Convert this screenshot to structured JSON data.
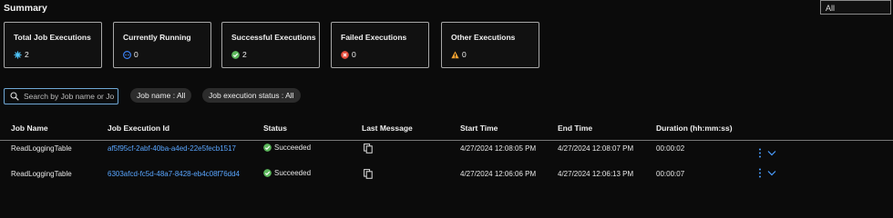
{
  "summary": {
    "title": "Summary",
    "filter_value": "All",
    "cards": [
      {
        "label": "Total Job Executions",
        "value": "2",
        "icon": "gear-icon",
        "color": "#4fc3f7"
      },
      {
        "label": "Currently Running",
        "value": "0",
        "icon": "running-icon",
        "color": "#3b82f6"
      },
      {
        "label": "Successful Executions",
        "value": "2",
        "icon": "check-circle-icon",
        "color": "#5cb85c"
      },
      {
        "label": "Failed Executions",
        "value": "0",
        "icon": "error-circle-icon",
        "color": "#e74c3c"
      },
      {
        "label": "Other Executions",
        "value": "0",
        "icon": "warning-icon",
        "color": "#f0a030"
      }
    ]
  },
  "filters": {
    "search_placeholder": "Search by Job name or Jo...",
    "job_name_pill": "Job name : All",
    "status_pill": "Job execution status : All"
  },
  "table": {
    "columns": [
      "Job Name",
      "Job Execution Id",
      "Status",
      "Last Message",
      "Start Time",
      "End Time",
      "Duration (hh:mm:ss)"
    ],
    "rows": [
      {
        "job_name": "ReadLoggingTable",
        "execution_id": "af5f95cf-2abf-40ba-a4ed-22e5fecb1517",
        "status": "Succeeded",
        "start_time": "4/27/2024 12:08:05 PM",
        "end_time": "4/27/2024 12:08:07 PM",
        "duration": "00:00:02"
      },
      {
        "job_name": "ReadLoggingTable",
        "execution_id": "6303afcd-fc5d-48a7-8428-eb4c08f76dd4",
        "status": "Succeeded",
        "start_time": "4/27/2024 12:06:06 PM",
        "end_time": "4/27/2024 12:06:13 PM",
        "duration": "00:00:07"
      }
    ]
  }
}
